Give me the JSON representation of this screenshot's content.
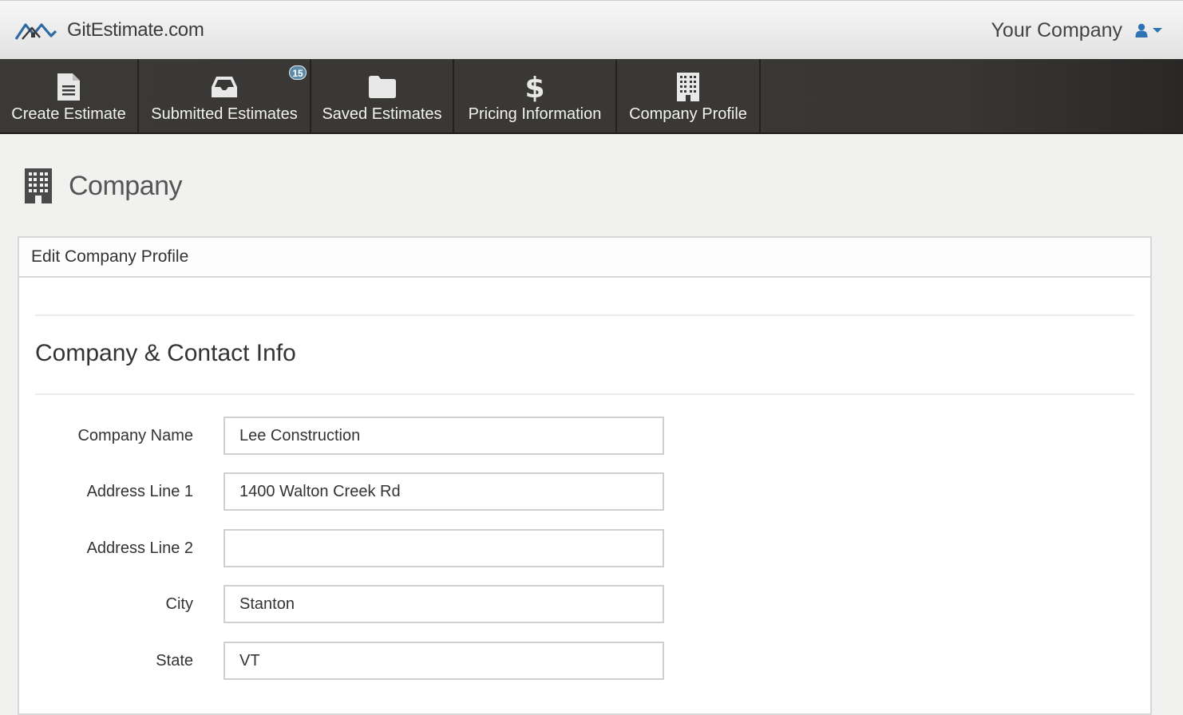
{
  "header": {
    "logo_text": "GitEstimate.com",
    "company_label": "Your Company",
    "user_icon": "user-icon",
    "dropdown_icon": "caret-down-icon",
    "accent_color": "#2f73b5"
  },
  "nav": {
    "items": [
      {
        "label": "Create Estimate",
        "icon": "file-icon"
      },
      {
        "label": "Submitted Estimates",
        "icon": "inbox-icon",
        "badge": "15"
      },
      {
        "label": "Saved Estimates",
        "icon": "folder-icon"
      },
      {
        "label": "Pricing Information",
        "icon": "dollar-icon"
      },
      {
        "label": "Company Profile",
        "icon": "building-icon"
      }
    ]
  },
  "page": {
    "title": "Company",
    "icon": "building-icon"
  },
  "panel": {
    "header": "Edit Company Profile",
    "section_title": "Company & Contact Info",
    "fields": [
      {
        "label": "Company Name",
        "value": "Lee Construction"
      },
      {
        "label": "Address Line 1",
        "value": "1400 Walton Creek Rd"
      },
      {
        "label": "Address Line 2",
        "value": ""
      },
      {
        "label": "City",
        "value": "Stanton"
      },
      {
        "label": "State",
        "value": "VT"
      }
    ]
  }
}
